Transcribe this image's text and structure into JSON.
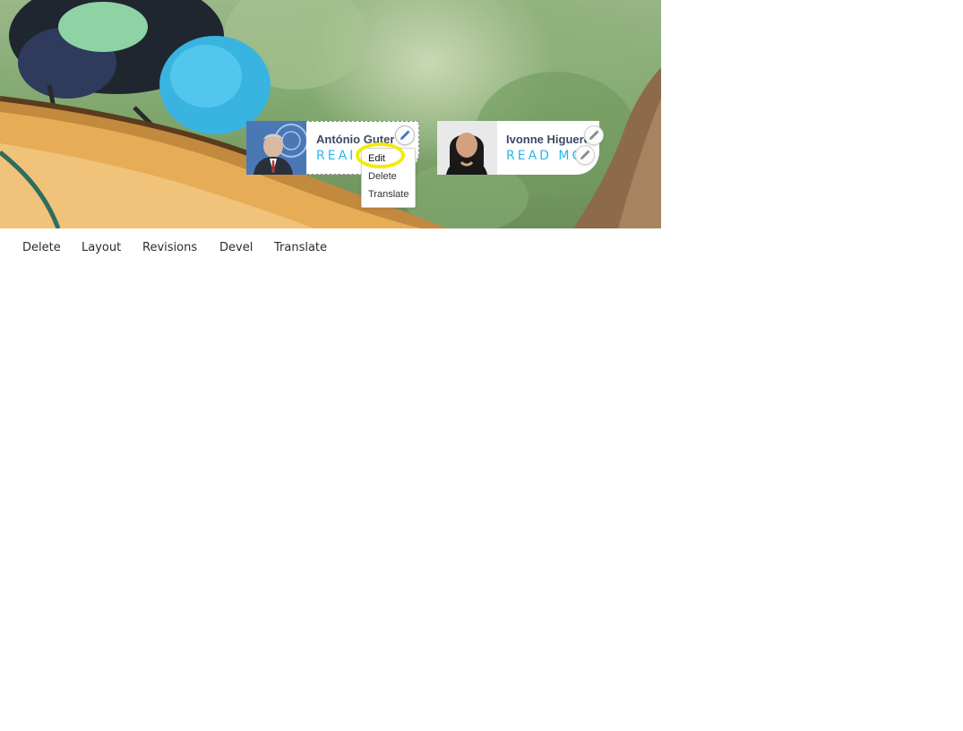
{
  "cards": [
    {
      "name": "António Guterr",
      "read_more": "READ MORE",
      "photo_alt": "António Guterres portrait"
    },
    {
      "name": "Ivonne Higuero",
      "read_more": "READ MORE",
      "photo_alt": "Ivonne Higuero portrait"
    }
  ],
  "context_menu": {
    "items": [
      "Edit",
      "Delete",
      "Translate"
    ]
  },
  "tabs": [
    "Delete",
    "Layout",
    "Revisions",
    "Devel",
    "Translate"
  ],
  "colors": {
    "accent": "#29b6ea",
    "name_text": "#3b4a64",
    "highlight": "#f3ea0f",
    "pencil_active": "#3a79c0",
    "pencil_inactive": "#8a8a8a"
  },
  "icons": {
    "edit_trigger": "pencil-icon"
  }
}
